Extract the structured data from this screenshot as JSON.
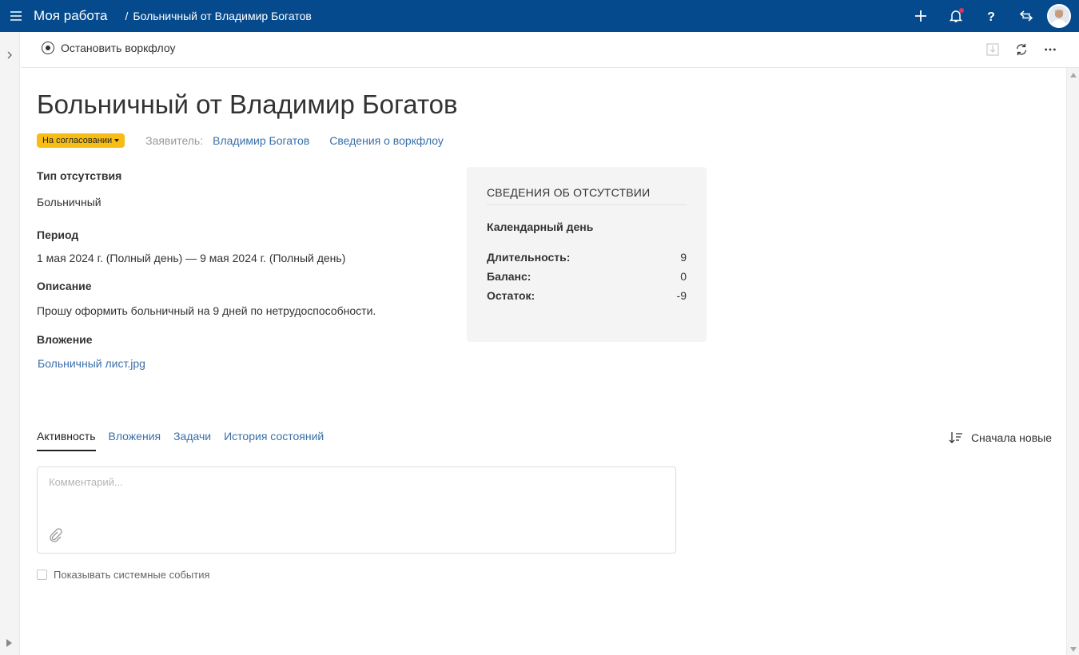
{
  "topbar": {
    "app_title": "Моя работа",
    "breadcrumb_sep": "/",
    "breadcrumb": "Больничный от Владимир Богатов"
  },
  "toolbar": {
    "stop_workflow": "Остановить воркфлоу"
  },
  "page": {
    "title": "Больничный от Владимир Богатов",
    "status": "На согласовании",
    "applicant_label": "Заявитель:",
    "applicant_name": "Владимир Богатов",
    "workflow_info_link": "Сведения о воркфлоу"
  },
  "fields": {
    "type_label": "Тип отсутствия",
    "type_value": "Больничный",
    "period_label": "Период",
    "period_value": "1 мая 2024 г. (Полный день) — 9 мая 2024 г. (Полный день)",
    "description_label": "Описание",
    "description_value": "Прошу оформить больничный на 9 дней по нетрудоспособности.",
    "attachment_label": "Вложение",
    "attachment_file": "Больничный лист.jpg"
  },
  "absence_card": {
    "title": "СВЕДЕНИЯ ОБ ОТСУТСТВИИ",
    "subtitle": "Календарный день",
    "rows": [
      {
        "key": "Длительность:",
        "value": "9"
      },
      {
        "key": "Баланс:",
        "value": "0"
      },
      {
        "key": "Остаток:",
        "value": "-9"
      }
    ]
  },
  "tabs": [
    {
      "label": "Активность",
      "active": true
    },
    {
      "label": "Вложения",
      "active": false
    },
    {
      "label": "Задачи",
      "active": false
    },
    {
      "label": "История состояний",
      "active": false
    }
  ],
  "sort_label": "Сначала новые",
  "comment": {
    "placeholder": "Комментарий..."
  },
  "show_system_events": "Показывать системные события",
  "colors": {
    "topbar": "#054a8c",
    "status_badge": "#f6bd16",
    "link": "#3a6fa8",
    "notification_dot": "#e0355a"
  }
}
